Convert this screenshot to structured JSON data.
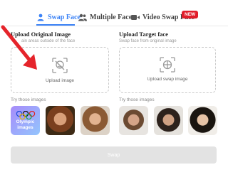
{
  "tabs": [
    {
      "label": "Swap Face",
      "icon": "user-icon",
      "active": true
    },
    {
      "label": "Multiple Faces",
      "icon": "users-icon",
      "active": false
    },
    {
      "label": "Video Swap Face",
      "icon": "video-icon",
      "active": false,
      "badge": "NEW"
    }
  ],
  "left": {
    "title": "Upload Original Image",
    "subtitle": "ain areas outside of the face",
    "upload_label": "Upload image",
    "try_label": "Try those images",
    "olympic_label_1": "Olympic",
    "olympic_label_2": "images"
  },
  "right": {
    "title": "Upload Target face",
    "subtitle": "Swap face from original image",
    "upload_label": "Upload swap image",
    "try_label": "Try those images"
  },
  "swap_button": "Swap",
  "colors": {
    "accent": "#3b82f6",
    "badge": "#e11d2a",
    "arrow": "#e5242b"
  }
}
